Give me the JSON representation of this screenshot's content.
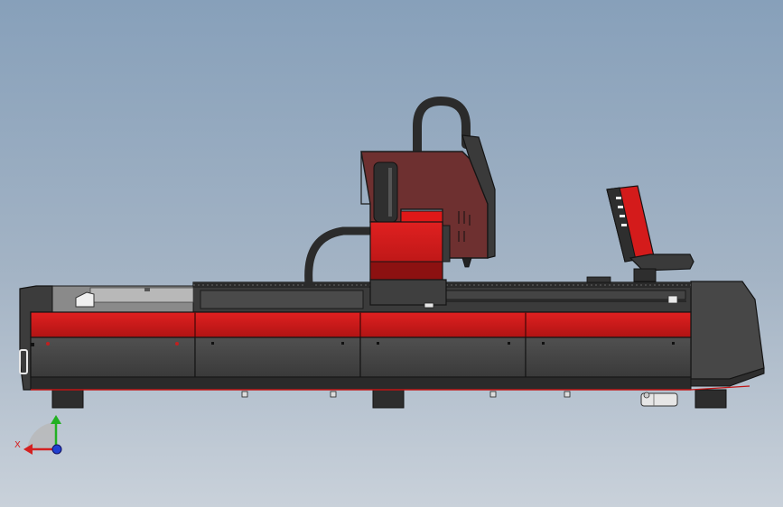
{
  "view": {
    "background_top": "#87a0ba",
    "background_bottom": "#c9d1da"
  },
  "machine": {
    "body_color": "#4a4a4a",
    "accent_red": "#d41b1b",
    "dark_red": "#8c1111",
    "cover_tint": "#6e3030",
    "edge_dark": "#1c1c1c",
    "panel_count": 4
  },
  "triad": {
    "x_label": "X",
    "x_color": "#d42020",
    "y_color": "#22b022",
    "z_color": "#2040d0",
    "icon": "coordinate-triad-icon"
  }
}
